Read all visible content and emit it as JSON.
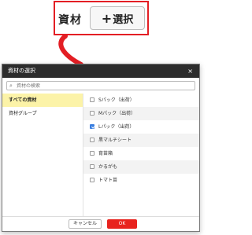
{
  "top_annotation": {
    "label": "資材",
    "button_plus": "+",
    "button_label": "選択"
  },
  "modal": {
    "title": "資材の選択",
    "close": "×",
    "search_placeholder": "資材の検索",
    "left_items": [
      {
        "label": "すべての資材",
        "active": true
      },
      {
        "label": "資材グループ",
        "active": false
      }
    ],
    "items": [
      {
        "label": "Sパック（出荷）",
        "checked": false
      },
      {
        "label": "Mパック（出荷）",
        "checked": false
      },
      {
        "label": "Lパック（出荷）",
        "checked": true
      },
      {
        "label": "黒マルチシート",
        "checked": false
      },
      {
        "label": "育苗箱",
        "checked": false
      },
      {
        "label": "かるがも",
        "checked": false
      },
      {
        "label": "トマト苗",
        "checked": false
      }
    ],
    "cancel_label": "キャンセル",
    "ok_label": "OK"
  },
  "colors": {
    "accent_red": "#e31e24",
    "header_dark": "#2c2c2c",
    "active_yellow": "#fcf3a8",
    "check_blue": "#3b7fe0"
  }
}
